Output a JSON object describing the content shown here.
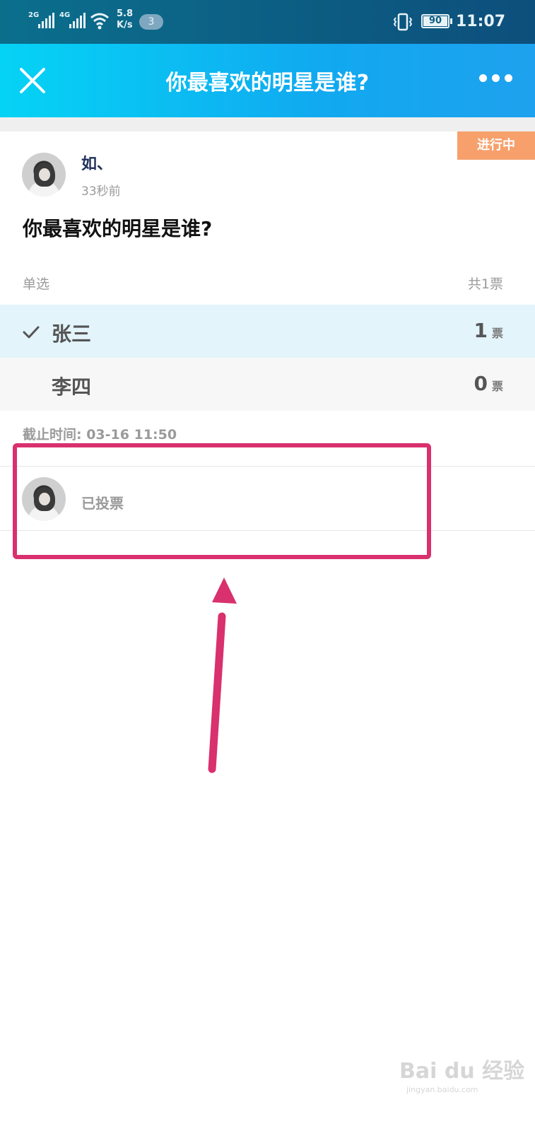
{
  "status_bar": {
    "signal1_label": "2G",
    "signal2_label": "4G",
    "net_speed_value": "5.8",
    "net_speed_unit": "K/s",
    "notification_count": "3",
    "battery": "90",
    "time": "11:07"
  },
  "header": {
    "title": "你最喜欢的明星是谁?",
    "close_icon": "close-icon",
    "more_icon": "more-dots-icon",
    "background_start": "#05d3f5",
    "background_end": "#1ea1ee"
  },
  "poll": {
    "status_tag": "进行中",
    "author": "如、",
    "time_ago": "33秒前",
    "question": "你最喜欢的明星是谁?",
    "vote_type": "单选",
    "total_votes": "共1票",
    "options": [
      {
        "label": "张三",
        "count": "1",
        "unit": "票",
        "selected": true
      },
      {
        "label": "李四",
        "count": "0",
        "unit": "票",
        "selected": false
      }
    ],
    "deadline": "截止时间: 03-16 11:50",
    "voters_label": "已投票"
  },
  "annotation": {
    "highlight_color": "#d9306e"
  },
  "watermark": {
    "text": "Bai du 经验",
    "url": "jingyan.baidu.com"
  }
}
